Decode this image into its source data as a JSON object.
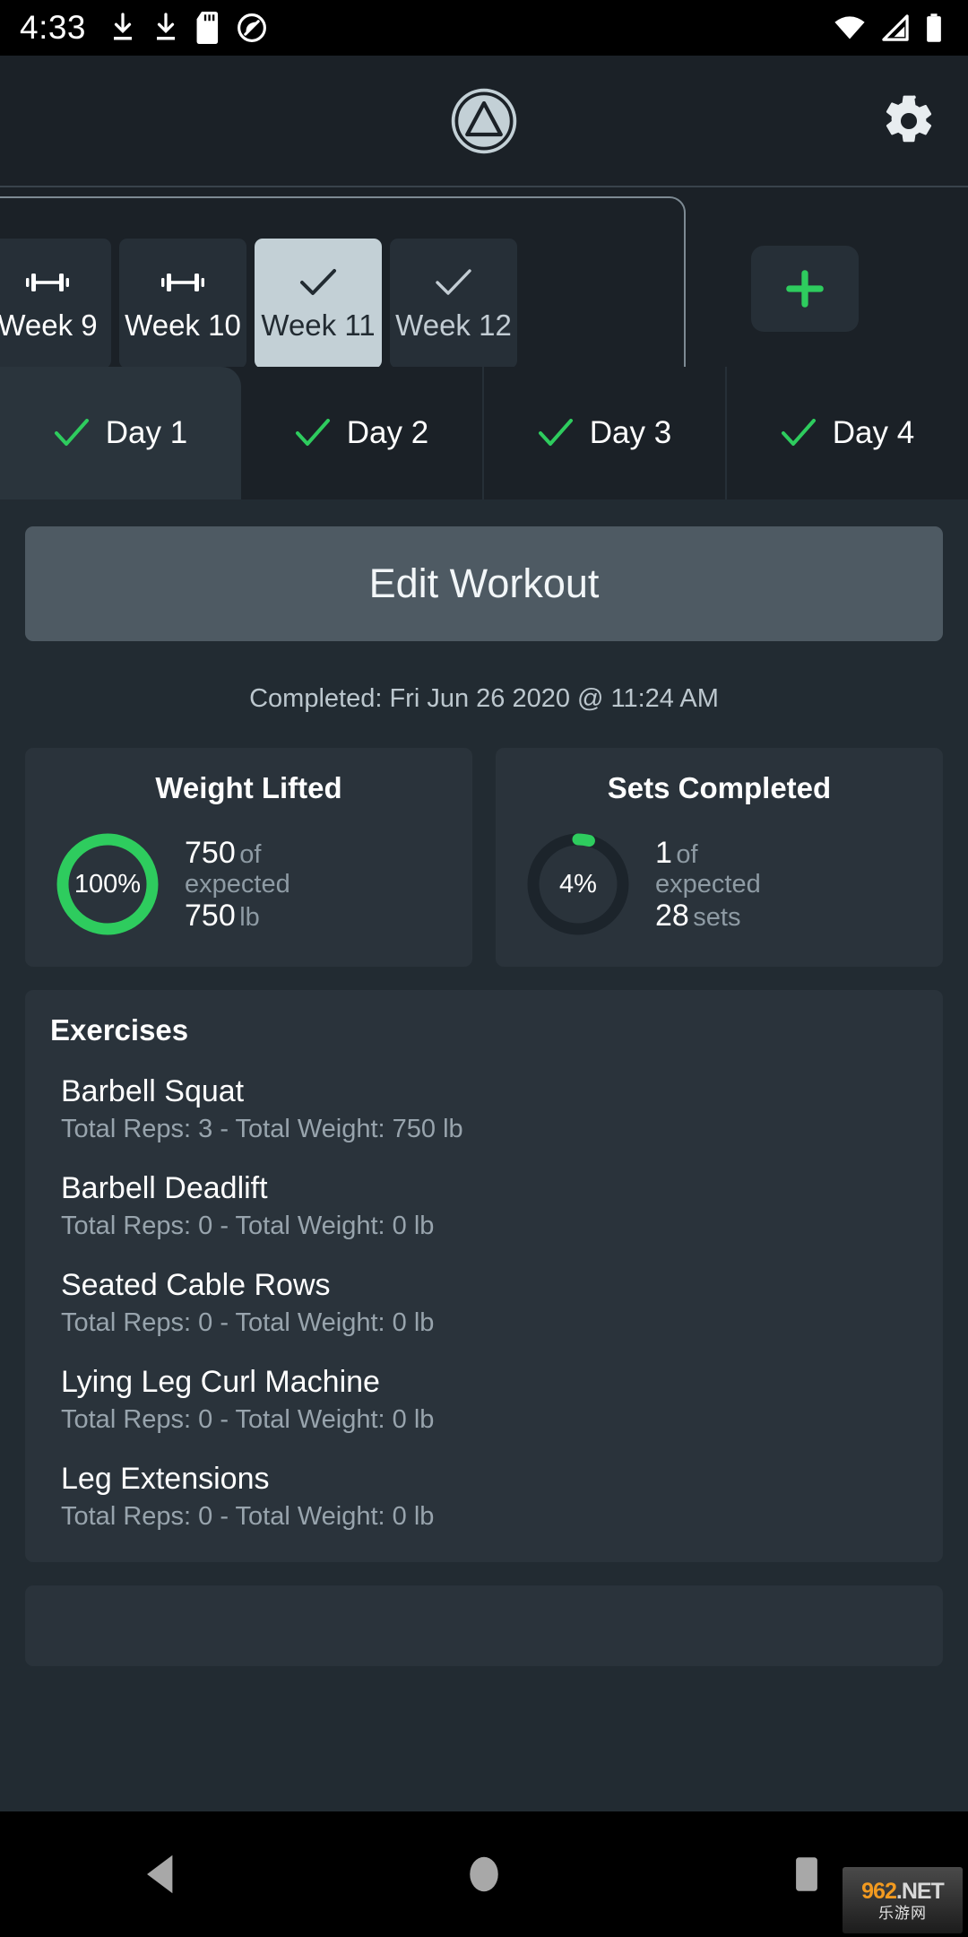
{
  "status_bar": {
    "time": "4:33",
    "left_icons": [
      "download-icon",
      "download-icon",
      "sd-card-icon",
      "do-not-disturb-icon"
    ],
    "right_icons": [
      "wifi-icon",
      "cellular-signal-icon",
      "battery-icon"
    ]
  },
  "app_header": {
    "logo": "triangle-in-circle-logo",
    "settings": "gear-icon"
  },
  "week_tabs": {
    "add_button_label": "+",
    "items": [
      {
        "label": "Week 9",
        "icon": "dumbbell-icon",
        "state": "pending",
        "selected": false
      },
      {
        "label": "Week 10",
        "icon": "dumbbell-icon",
        "state": "pending",
        "selected": false
      },
      {
        "label": "Week 11",
        "icon": "check-icon",
        "state": "completed",
        "selected": true
      },
      {
        "label": "Week 12",
        "icon": "check-icon",
        "state": "completed",
        "selected": false
      }
    ]
  },
  "day_tabs": {
    "items": [
      {
        "label": "Day 1",
        "icon": "check-icon",
        "selected": true
      },
      {
        "label": "Day 2",
        "icon": "check-icon",
        "selected": false
      },
      {
        "label": "Day 3",
        "icon": "check-icon",
        "selected": false
      },
      {
        "label": "Day 4",
        "icon": "check-icon",
        "selected": false
      }
    ]
  },
  "workout": {
    "edit_button_label": "Edit Workout",
    "completed_text": "Completed: Fri Jun 26 2020 @ 11:24 AM"
  },
  "stats": [
    {
      "title": "Weight Lifted",
      "percent_label": "100%",
      "percent_value": 100,
      "actual": "750",
      "of_label": "of",
      "expected_label": "expected",
      "expected": "750",
      "unit": "lb"
    },
    {
      "title": "Sets Completed",
      "percent_label": "4%",
      "percent_value": 4,
      "actual": "1",
      "of_label": "of",
      "expected_label": "expected",
      "expected": "28",
      "unit": "sets"
    }
  ],
  "exercises": {
    "title": "Exercises",
    "items": [
      {
        "name": "Barbell Squat",
        "meta": "Total Reps: 3  -  Total Weight: 750 lb"
      },
      {
        "name": "Barbell Deadlift",
        "meta": "Total Reps: 0  -  Total Weight: 0 lb"
      },
      {
        "name": "Seated Cable Rows",
        "meta": "Total Reps: 0  -  Total Weight: 0 lb"
      },
      {
        "name": "Lying Leg Curl Machine",
        "meta": "Total Reps: 0  -  Total Weight: 0 lb"
      },
      {
        "name": "Leg Extensions",
        "meta": "Total Reps: 0  -  Total Weight: 0 lb"
      }
    ]
  },
  "nav_bar": {
    "back": "back-triangle-icon",
    "home": "home-circle-icon",
    "recents": "recents-square-icon"
  },
  "watermark": {
    "number": "962",
    "dot": ".",
    "net": "NET",
    "cn": "乐游网"
  },
  "colors": {
    "accent_green": "#2ecc5e",
    "page_bg": "#222b32",
    "header_bg": "#1b2127",
    "card_bg": "#2a333b",
    "selected_tab_bg": "#c3d0d6",
    "edit_button_bg": "#4e5a63"
  }
}
